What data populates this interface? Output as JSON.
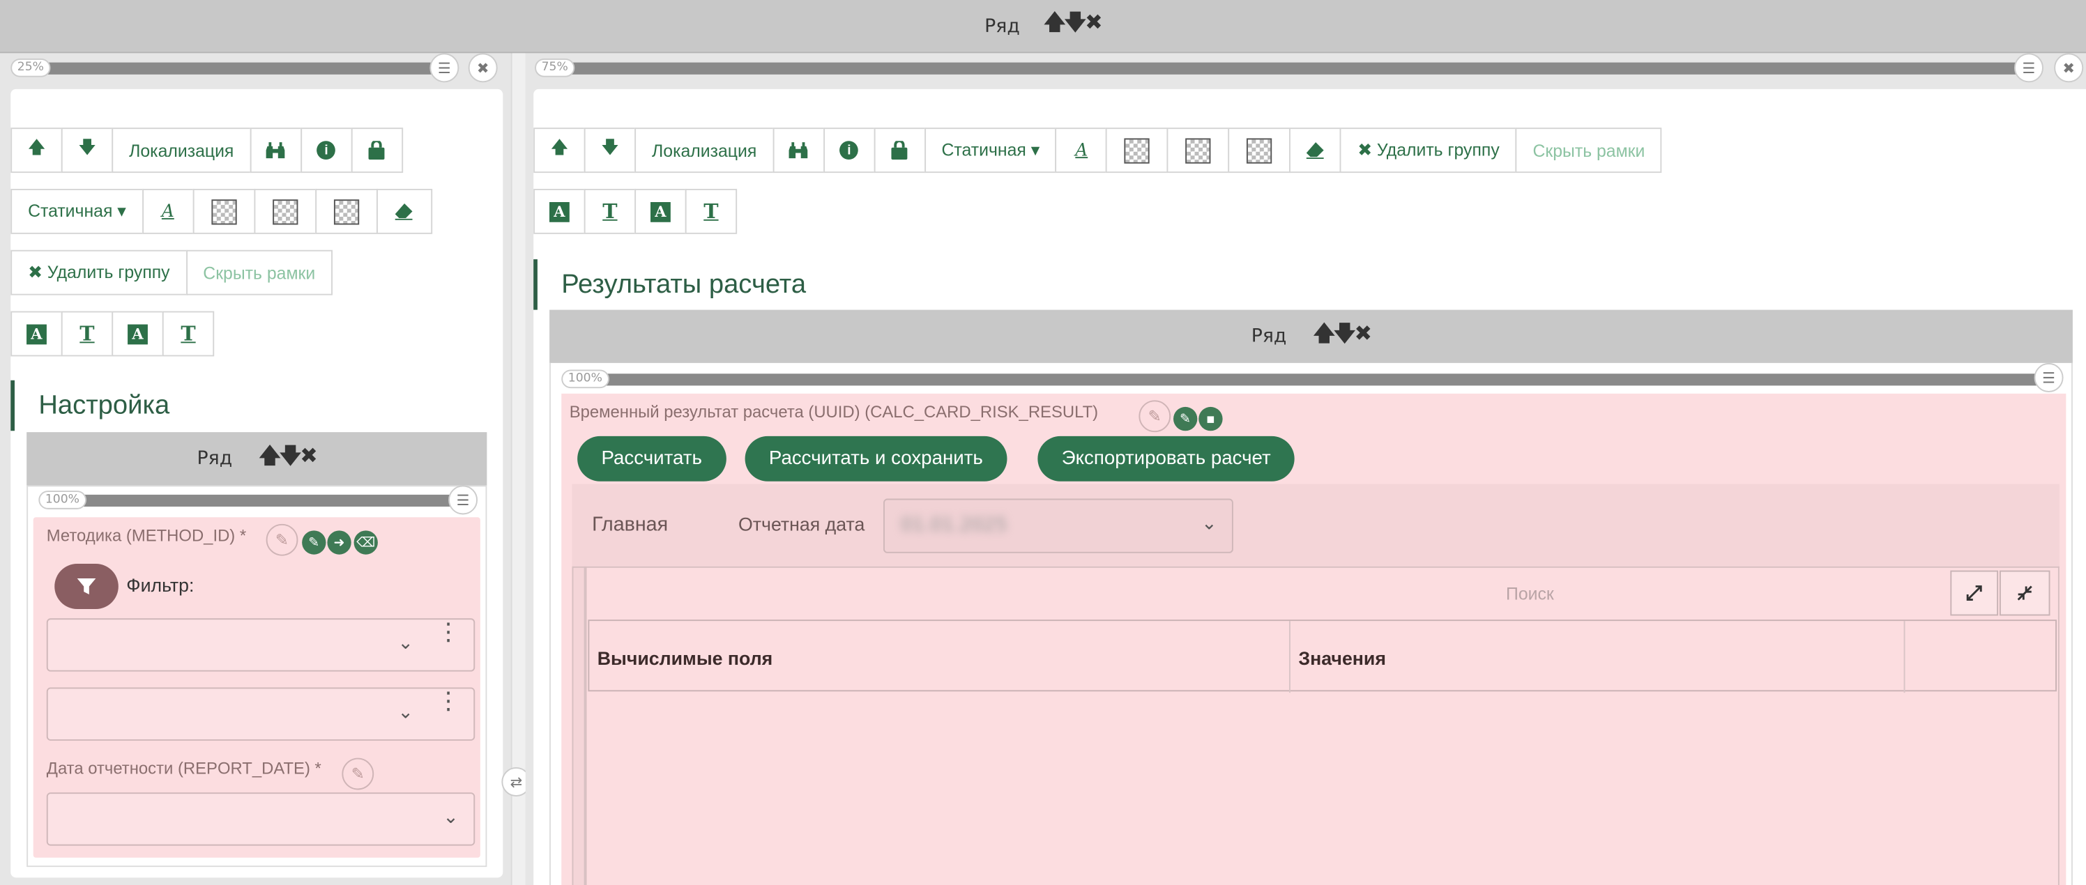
{
  "top_row": {
    "label": "Ряд",
    "controls": "🡅🡇✖"
  },
  "left_column": {
    "percent": "25%",
    "toolbar": {
      "row1": {
        "up": "🡅",
        "down": "🡇",
        "localization": "Локализация",
        "binoculars": "binoculars-icon",
        "info": "i",
        "lock": "lock-icon"
      },
      "row2": {
        "static": "Статичная ▾",
        "font_a": "A"
      },
      "row3": {
        "delete_group": "✖ Удалить группу",
        "hide_frames": "Скрыть рамки"
      },
      "row4": [
        "A",
        "T",
        "A",
        "T"
      ]
    },
    "section_title": "Настройка",
    "inner_row": {
      "label": "Ряд",
      "controls": "🡅🡇✖",
      "percent": "100%"
    },
    "method_field": {
      "label": "Методика (METHOD_ID) *",
      "filter_label": "Фильтр:"
    },
    "report_date_field": {
      "label": "Дата отчетности (REPORT_DATE) *"
    }
  },
  "right_column": {
    "percent": "75%",
    "toolbar": {
      "localization": "Локализация",
      "static": "Статичная ▾",
      "delete_group": "✖ Удалить группу",
      "hide_frames": "Скрыть рамки",
      "row2": [
        "A",
        "T",
        "A",
        "T"
      ]
    },
    "section_title": "Результаты расчета",
    "inner_row": {
      "label": "Ряд",
      "controls": "🡅🡇✖",
      "percent": "100%"
    },
    "result_block": {
      "label": "Временный результат расчета (UUID) (CALC_CARD_RISK_RESULT)",
      "buttons": {
        "calculate": "Рассчитать",
        "calculate_save": "Рассчитать и сохранить",
        "export": "Экспортировать расчет"
      },
      "tab_main": "Главная",
      "report_date_label": "Отчетная дата",
      "report_date_value": "01.01.2025",
      "search_placeholder": "Поиск",
      "table_headers": [
        "Вычислимые поля",
        "Значения"
      ]
    }
  },
  "colors": {
    "accent": "#2d7048",
    "pink": "#fcdde0",
    "grey": "#c8c8c8"
  }
}
